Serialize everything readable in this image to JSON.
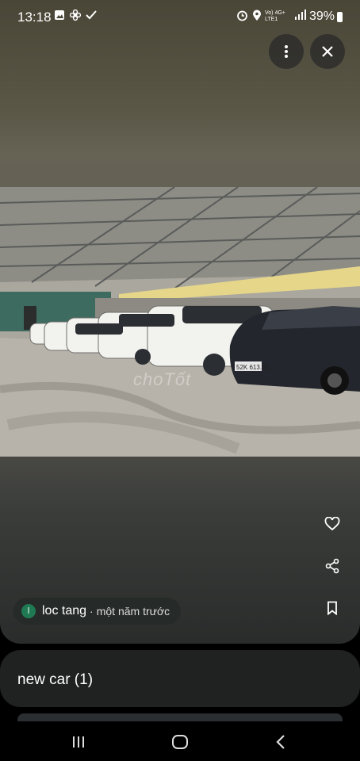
{
  "status_bar": {
    "time": "13:18",
    "left_icons": [
      "gallery-icon",
      "fan-icon",
      "check-icon"
    ],
    "right_icons": [
      "alarm-icon",
      "location-icon",
      "volte-icon",
      "4g-icon",
      "signal-icon"
    ],
    "network_label": "Vo) 4G+\nLTE1",
    "battery": "39%"
  },
  "top_actions": {
    "menu_icon": "more-vertical-icon",
    "close_icon": "close-icon"
  },
  "photo": {
    "watermark": "choTốt",
    "plate": "52K 613.05"
  },
  "side_actions": [
    "heart-icon",
    "share-icon",
    "bookmark-icon"
  ],
  "author_chip": {
    "avatar_letter": "l",
    "avatar_color": "#1f7a53",
    "username": "loc tang",
    "separator": "·",
    "posted": "một năm trước"
  },
  "album": {
    "title": "new car (1)"
  },
  "nav": [
    "recent-apps-icon",
    "home-icon",
    "back-icon"
  ]
}
